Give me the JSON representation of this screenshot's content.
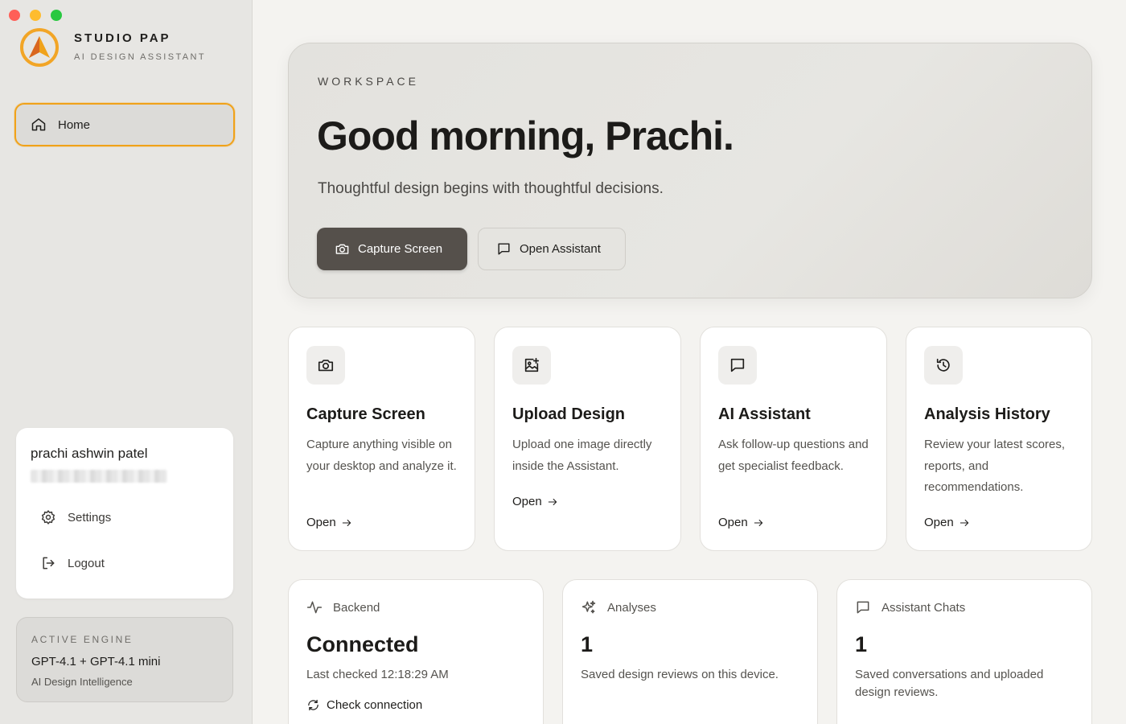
{
  "brand": {
    "name": "STUDIO PAP",
    "subtitle": "AI DESIGN ASSISTANT",
    "accent": "#f0a21a"
  },
  "sidebar": {
    "nav": [
      {
        "label": "Home",
        "icon": "home-icon",
        "active": true
      }
    ],
    "user": {
      "name": "prachi ashwin patel",
      "settings_label": "Settings",
      "logout_label": "Logout"
    },
    "engine": {
      "kicker": "ACTIVE ENGINE",
      "model": "GPT-4.1 + GPT-4.1 mini",
      "description": "AI Design Intelligence"
    }
  },
  "hero": {
    "kicker": "WORKSPACE",
    "title": "Good morning, Prachi.",
    "subtitle": "Thoughtful design begins with thoughtful decisions.",
    "primary_button": "Capture Screen",
    "secondary_button": "Open Assistant"
  },
  "features": [
    {
      "icon": "camera-icon",
      "title": "Capture Screen",
      "description": "Capture anything visible on your desktop and analyze it.",
      "action": "Open"
    },
    {
      "icon": "image-upload-icon",
      "title": "Upload Design",
      "description": "Upload one image directly inside the Assistant.",
      "action": "Open"
    },
    {
      "icon": "chat-icon",
      "title": "AI Assistant",
      "description": "Ask follow-up questions and get specialist feedback.",
      "action": "Open"
    },
    {
      "icon": "history-icon",
      "title": "Analysis History",
      "description": "Review your latest scores, reports, and recommendations.",
      "action": "Open"
    }
  ],
  "status": {
    "backend": {
      "label": "Backend",
      "value": "Connected",
      "note": "Last checked 12:18:29 AM",
      "action": "Check connection"
    },
    "analyses": {
      "label": "Analyses",
      "value": "1",
      "note": "Saved design reviews on this device."
    },
    "chats": {
      "label": "Assistant Chats",
      "value": "1",
      "note": "Saved conversations and uploaded design reviews."
    }
  }
}
